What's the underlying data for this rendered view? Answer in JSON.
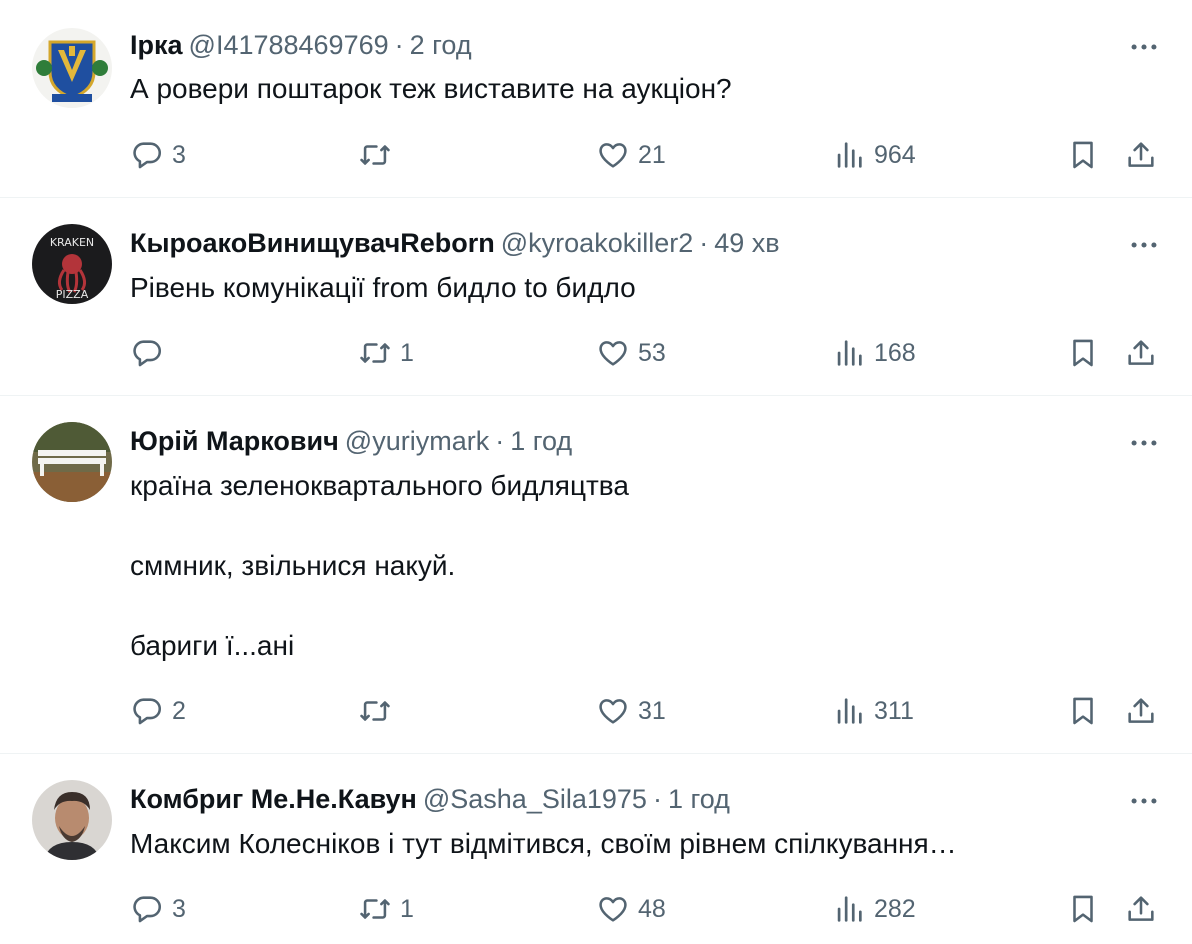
{
  "tweets": [
    {
      "name": "Ірка",
      "handle": "@I41788469769",
      "separator": "·",
      "time": "2 год",
      "paragraphs": [
        "А ровери поштарок теж виставите на аукціон?"
      ],
      "replies": "3",
      "retweets": "",
      "likes": "21",
      "views": "964"
    },
    {
      "name": "КыроакоВинищувачReborn",
      "handle": "@kyroakokiller2",
      "separator": "·",
      "time": "49 хв",
      "paragraphs": [
        "Рівень комунікації from бидло to бидло"
      ],
      "replies": "",
      "retweets": "1",
      "likes": "53",
      "views": "168",
      "avatar_text": [
        "KRAKEN",
        "PIZZA"
      ]
    },
    {
      "name": "Юрій Маркович",
      "handle": "@yuriymark",
      "separator": "·",
      "time": "1 год",
      "paragraphs": [
        "країна зеленоквартального бидляцтва",
        "сммник, звільнися накуй.",
        "бариги ї...ані"
      ],
      "replies": "2",
      "retweets": "",
      "likes": "31",
      "views": "311"
    },
    {
      "name": "Комбриг Ме.Не.Кавун",
      "handle": "@Sasha_Sila1975",
      "separator": "·",
      "time": "1 год",
      "paragraphs": [
        "Максим Колесніков і тут відмітився, своїм рівнем спілкування…"
      ],
      "replies": "3",
      "retweets": "1",
      "likes": "48",
      "views": "282"
    }
  ],
  "icons": {
    "more": "more-dots-icon",
    "reply": "reply-bubble-icon",
    "retweet": "retweet-icon",
    "like": "heart-icon",
    "views": "views-bar-chart-icon",
    "bookmark": "bookmark-icon",
    "share": "share-upload-icon"
  },
  "colors": {
    "text": "#0f1419",
    "secondary": "#536471",
    "divider": "#eff3f4",
    "background": "#ffffff"
  }
}
